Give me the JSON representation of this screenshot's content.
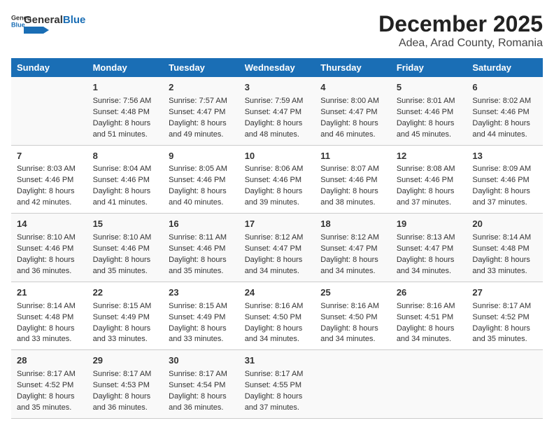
{
  "header": {
    "logo_general": "General",
    "logo_blue": "Blue",
    "title": "December 2025",
    "subtitle": "Adea, Arad County, Romania"
  },
  "calendar": {
    "days_of_week": [
      "Sunday",
      "Monday",
      "Tuesday",
      "Wednesday",
      "Thursday",
      "Friday",
      "Saturday"
    ],
    "weeks": [
      [
        {
          "day": "",
          "info": ""
        },
        {
          "day": "1",
          "info": "Sunrise: 7:56 AM\nSunset: 4:48 PM\nDaylight: 8 hours\nand 51 minutes."
        },
        {
          "day": "2",
          "info": "Sunrise: 7:57 AM\nSunset: 4:47 PM\nDaylight: 8 hours\nand 49 minutes."
        },
        {
          "day": "3",
          "info": "Sunrise: 7:59 AM\nSunset: 4:47 PM\nDaylight: 8 hours\nand 48 minutes."
        },
        {
          "day": "4",
          "info": "Sunrise: 8:00 AM\nSunset: 4:47 PM\nDaylight: 8 hours\nand 46 minutes."
        },
        {
          "day": "5",
          "info": "Sunrise: 8:01 AM\nSunset: 4:46 PM\nDaylight: 8 hours\nand 45 minutes."
        },
        {
          "day": "6",
          "info": "Sunrise: 8:02 AM\nSunset: 4:46 PM\nDaylight: 8 hours\nand 44 minutes."
        }
      ],
      [
        {
          "day": "7",
          "info": "Sunrise: 8:03 AM\nSunset: 4:46 PM\nDaylight: 8 hours\nand 42 minutes."
        },
        {
          "day": "8",
          "info": "Sunrise: 8:04 AM\nSunset: 4:46 PM\nDaylight: 8 hours\nand 41 minutes."
        },
        {
          "day": "9",
          "info": "Sunrise: 8:05 AM\nSunset: 4:46 PM\nDaylight: 8 hours\nand 40 minutes."
        },
        {
          "day": "10",
          "info": "Sunrise: 8:06 AM\nSunset: 4:46 PM\nDaylight: 8 hours\nand 39 minutes."
        },
        {
          "day": "11",
          "info": "Sunrise: 8:07 AM\nSunset: 4:46 PM\nDaylight: 8 hours\nand 38 minutes."
        },
        {
          "day": "12",
          "info": "Sunrise: 8:08 AM\nSunset: 4:46 PM\nDaylight: 8 hours\nand 37 minutes."
        },
        {
          "day": "13",
          "info": "Sunrise: 8:09 AM\nSunset: 4:46 PM\nDaylight: 8 hours\nand 37 minutes."
        }
      ],
      [
        {
          "day": "14",
          "info": "Sunrise: 8:10 AM\nSunset: 4:46 PM\nDaylight: 8 hours\nand 36 minutes."
        },
        {
          "day": "15",
          "info": "Sunrise: 8:10 AM\nSunset: 4:46 PM\nDaylight: 8 hours\nand 35 minutes."
        },
        {
          "day": "16",
          "info": "Sunrise: 8:11 AM\nSunset: 4:46 PM\nDaylight: 8 hours\nand 35 minutes."
        },
        {
          "day": "17",
          "info": "Sunrise: 8:12 AM\nSunset: 4:47 PM\nDaylight: 8 hours\nand 34 minutes."
        },
        {
          "day": "18",
          "info": "Sunrise: 8:12 AM\nSunset: 4:47 PM\nDaylight: 8 hours\nand 34 minutes."
        },
        {
          "day": "19",
          "info": "Sunrise: 8:13 AM\nSunset: 4:47 PM\nDaylight: 8 hours\nand 34 minutes."
        },
        {
          "day": "20",
          "info": "Sunrise: 8:14 AM\nSunset: 4:48 PM\nDaylight: 8 hours\nand 33 minutes."
        }
      ],
      [
        {
          "day": "21",
          "info": "Sunrise: 8:14 AM\nSunset: 4:48 PM\nDaylight: 8 hours\nand 33 minutes."
        },
        {
          "day": "22",
          "info": "Sunrise: 8:15 AM\nSunset: 4:49 PM\nDaylight: 8 hours\nand 33 minutes."
        },
        {
          "day": "23",
          "info": "Sunrise: 8:15 AM\nSunset: 4:49 PM\nDaylight: 8 hours\nand 33 minutes."
        },
        {
          "day": "24",
          "info": "Sunrise: 8:16 AM\nSunset: 4:50 PM\nDaylight: 8 hours\nand 34 minutes."
        },
        {
          "day": "25",
          "info": "Sunrise: 8:16 AM\nSunset: 4:50 PM\nDaylight: 8 hours\nand 34 minutes."
        },
        {
          "day": "26",
          "info": "Sunrise: 8:16 AM\nSunset: 4:51 PM\nDaylight: 8 hours\nand 34 minutes."
        },
        {
          "day": "27",
          "info": "Sunrise: 8:17 AM\nSunset: 4:52 PM\nDaylight: 8 hours\nand 35 minutes."
        }
      ],
      [
        {
          "day": "28",
          "info": "Sunrise: 8:17 AM\nSunset: 4:52 PM\nDaylight: 8 hours\nand 35 minutes."
        },
        {
          "day": "29",
          "info": "Sunrise: 8:17 AM\nSunset: 4:53 PM\nDaylight: 8 hours\nand 36 minutes."
        },
        {
          "day": "30",
          "info": "Sunrise: 8:17 AM\nSunset: 4:54 PM\nDaylight: 8 hours\nand 36 minutes."
        },
        {
          "day": "31",
          "info": "Sunrise: 8:17 AM\nSunset: 4:55 PM\nDaylight: 8 hours\nand 37 minutes."
        },
        {
          "day": "",
          "info": ""
        },
        {
          "day": "",
          "info": ""
        },
        {
          "day": "",
          "info": ""
        }
      ]
    ]
  }
}
